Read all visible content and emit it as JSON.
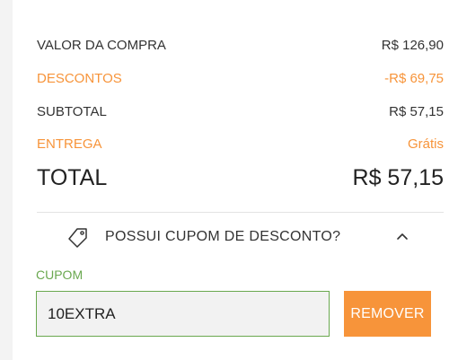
{
  "summary": {
    "valor_label": "VALOR DA COMPRA",
    "valor_value": "R$ 126,90",
    "descontos_label": "DESCONTOS",
    "descontos_value": "-R$ 69,75",
    "subtotal_label": "SUBTOTAL",
    "subtotal_value": "R$ 57,15",
    "entrega_label": "ENTREGA",
    "entrega_value": "Grátis",
    "total_label": "TOTAL",
    "total_value": "R$ 57,15"
  },
  "coupon": {
    "question": "POSSUI CUPOM DE DESCONTO?",
    "toggle_icon": "chevron-up-icon",
    "tag_icon": "tag-icon",
    "field_label": "CUPOM",
    "field_value": "10EXTRA",
    "remove_label": "REMOVER"
  },
  "colors": {
    "accent_orange": "#f7943a",
    "field_green": "#6aa84f",
    "text_dark": "#333333"
  }
}
